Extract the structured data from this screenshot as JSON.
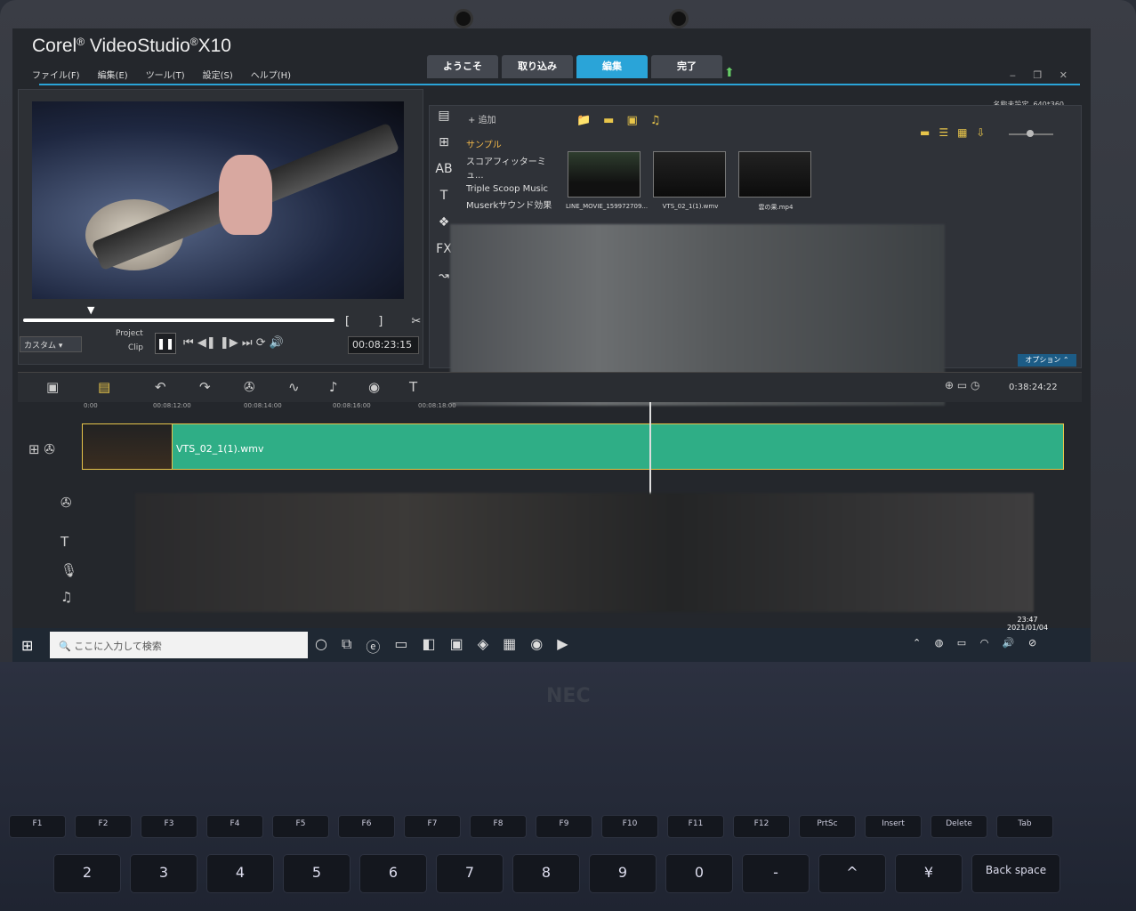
{
  "app": {
    "brand": "Corel",
    "product": "VideoStudio",
    "version": "X10"
  },
  "menu": [
    "ファイル(F)",
    "編集(E)",
    "ツール(T)",
    "設定(S)",
    "ヘルプ(H)"
  ],
  "tabs": [
    "ようこそ",
    "取り込み",
    "編集",
    "完了"
  ],
  "res_label": "名称未設定, 640*360",
  "player": {
    "mode": "カスタム",
    "project_label": "Project",
    "clip_label": "Clip",
    "timecode": "00:08:23:15"
  },
  "library": {
    "add_label": "追加",
    "folders": [
      "サンプル",
      "スコアフィッターミュ...",
      "Triple Scoop Music",
      "Muserkサウンド効果"
    ],
    "thumbs": [
      "LINE_MOVIE_159972709...",
      "VTS_02_1(1).wmv",
      "雲の果.mp4"
    ]
  },
  "timeline": {
    "clip_name": "VTS_02_1(1).wmv",
    "option_label": "オプション",
    "total_time": "0:38:24:22",
    "ruler": [
      "0:00",
      "00:08:12:00",
      "00:08:14:00",
      "00:08:16:00",
      "00:08:18:00"
    ]
  },
  "taskbar": {
    "search_placeholder": "ここに入力して検索",
    "time": "23:47",
    "date": "2021/01/04"
  },
  "keyboard": {
    "fn": [
      "F1",
      "F2",
      "F3",
      "F4",
      "F5",
      "F6",
      "F7",
      "F8",
      "F9",
      "F10",
      "F11",
      "F12",
      "PrtSc",
      "Insert",
      "Delete",
      "Tab"
    ],
    "num": [
      "2",
      "3",
      "4",
      "5",
      "6",
      "7",
      "8",
      "9",
      "0",
      "-",
      "^",
      "¥",
      "Back space"
    ]
  },
  "laptop_brand": "NEC"
}
